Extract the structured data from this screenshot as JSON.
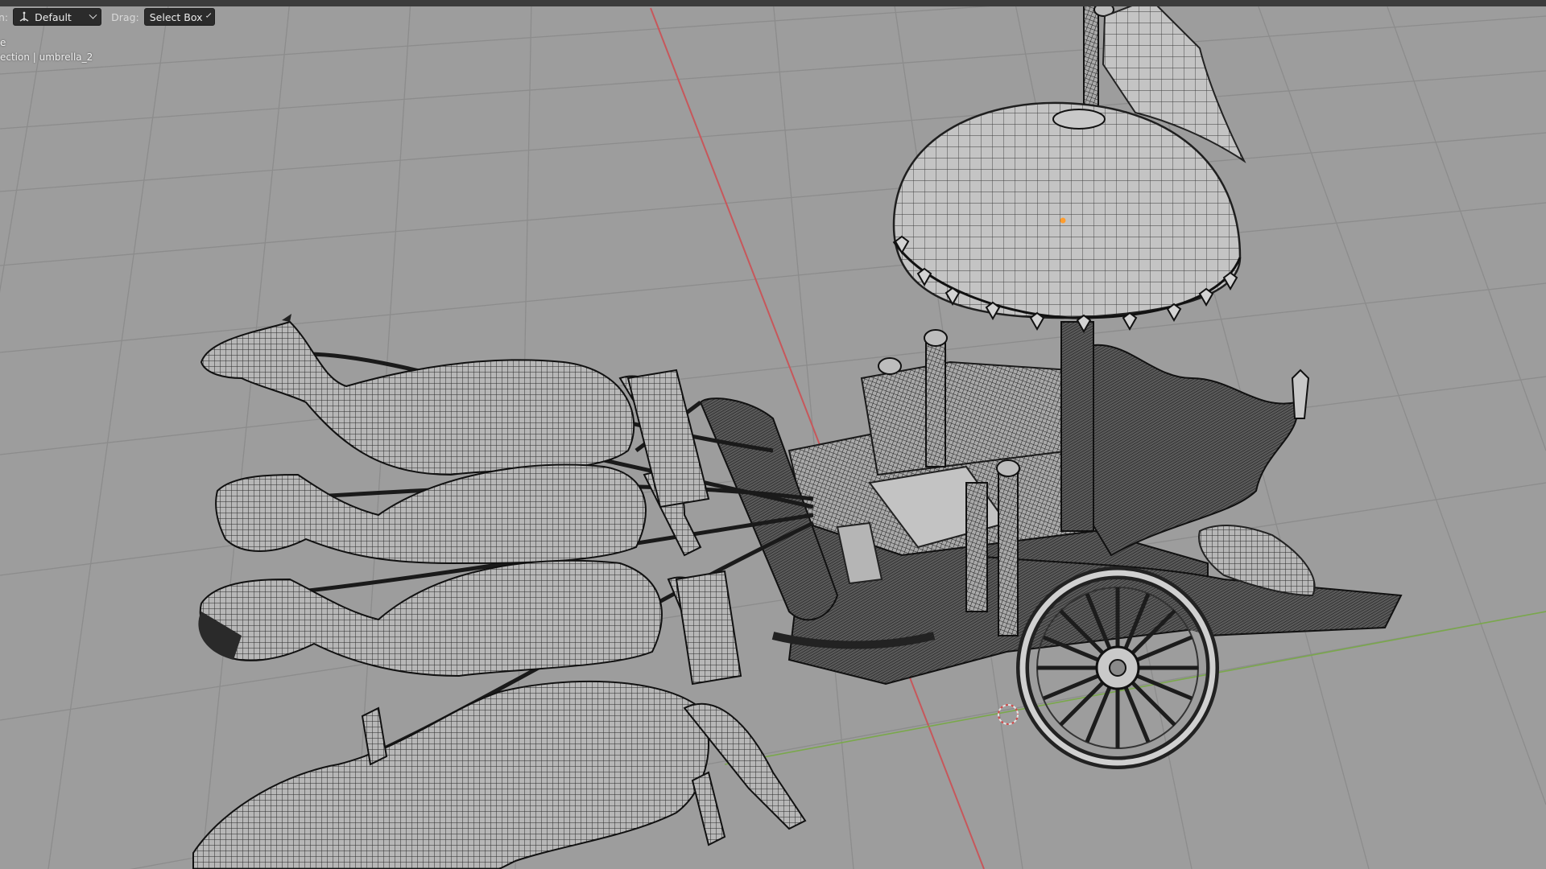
{
  "header": {
    "orientation_label": "n:",
    "orientation_value": "Default",
    "drag_label": "Drag:",
    "drag_value": "Select Box"
  },
  "overlay": {
    "view_name": "e",
    "collection_text": "ection | umbrella_2"
  },
  "scene": {
    "selected_object": "umbrella_2",
    "axis_colors": {
      "x_axis": "#c7575b",
      "y_axis": "#7aa84b"
    },
    "background_color": "#9d9d9d",
    "grid_color": "#8a8a8a",
    "mesh_color": "#1c1c1c",
    "origin_color": "#ff9d2e"
  }
}
